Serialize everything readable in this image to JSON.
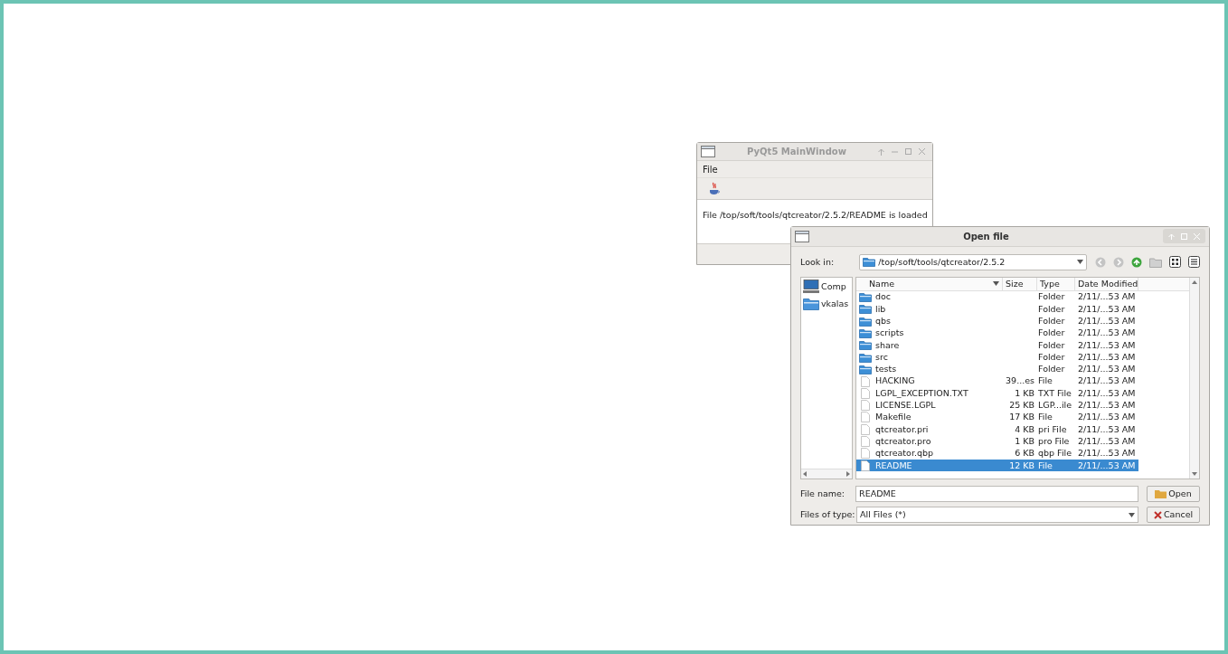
{
  "main_window": {
    "title": "PyQt5 MainWindow",
    "menu": [
      "File"
    ],
    "status_text": "File /top/soft/tools/qtcreator/2.5.2/README is loaded"
  },
  "dialog": {
    "title": "Open file",
    "look_in_label": "Look in:",
    "look_in_value": "/top/soft/tools/qtcreator/2.5.2",
    "sidebar": [
      {
        "label": "Comp",
        "kind": "computer"
      },
      {
        "label": "vkalas",
        "kind": "folder"
      }
    ],
    "columns": [
      "Name",
      "Size",
      "Type",
      "Date Modified"
    ],
    "rows": [
      {
        "name": "doc",
        "size": "",
        "type": "Folder",
        "date": "2/11/...53 AM",
        "kind": "folder",
        "selected": false
      },
      {
        "name": "lib",
        "size": "",
        "type": "Folder",
        "date": "2/11/...53 AM",
        "kind": "folder",
        "selected": false
      },
      {
        "name": "qbs",
        "size": "",
        "type": "Folder",
        "date": "2/11/...53 AM",
        "kind": "folder",
        "selected": false
      },
      {
        "name": "scripts",
        "size": "",
        "type": "Folder",
        "date": "2/11/...53 AM",
        "kind": "folder",
        "selected": false
      },
      {
        "name": "share",
        "size": "",
        "type": "Folder",
        "date": "2/11/...53 AM",
        "kind": "folder",
        "selected": false
      },
      {
        "name": "src",
        "size": "",
        "type": "Folder",
        "date": "2/11/...53 AM",
        "kind": "folder",
        "selected": false
      },
      {
        "name": "tests",
        "size": "",
        "type": "Folder",
        "date": "2/11/...53 AM",
        "kind": "folder",
        "selected": false
      },
      {
        "name": "HACKING",
        "size": "39...es",
        "type": "File",
        "date": "2/11/...53 AM",
        "kind": "file",
        "selected": false
      },
      {
        "name": "LGPL_EXCEPTION.TXT",
        "size": "1 KB",
        "type": "TXT File",
        "date": "2/11/...53 AM",
        "kind": "file",
        "selected": false
      },
      {
        "name": "LICENSE.LGPL",
        "size": "25 KB",
        "type": "LGP...ile",
        "date": "2/11/...53 AM",
        "kind": "file",
        "selected": false
      },
      {
        "name": "Makefile",
        "size": "17 KB",
        "type": "File",
        "date": "2/11/...53 AM",
        "kind": "file",
        "selected": false
      },
      {
        "name": "qtcreator.pri",
        "size": "4 KB",
        "type": "pri File",
        "date": "2/11/...53 AM",
        "kind": "file",
        "selected": false
      },
      {
        "name": "qtcreator.pro",
        "size": "1 KB",
        "type": "pro File",
        "date": "2/11/...53 AM",
        "kind": "file",
        "selected": false
      },
      {
        "name": "qtcreator.qbp",
        "size": "6 KB",
        "type": "qbp File",
        "date": "2/11/...53 AM",
        "kind": "file",
        "selected": false
      },
      {
        "name": "README",
        "size": "12 KB",
        "type": "File",
        "date": "2/11/...53 AM",
        "kind": "file",
        "selected": true
      }
    ],
    "file_name_label": "File name:",
    "file_name_value": "README",
    "file_type_label": "Files of type:",
    "file_type_value": "All Files (*)",
    "buttons": [
      "Open",
      "Cancel"
    ]
  }
}
